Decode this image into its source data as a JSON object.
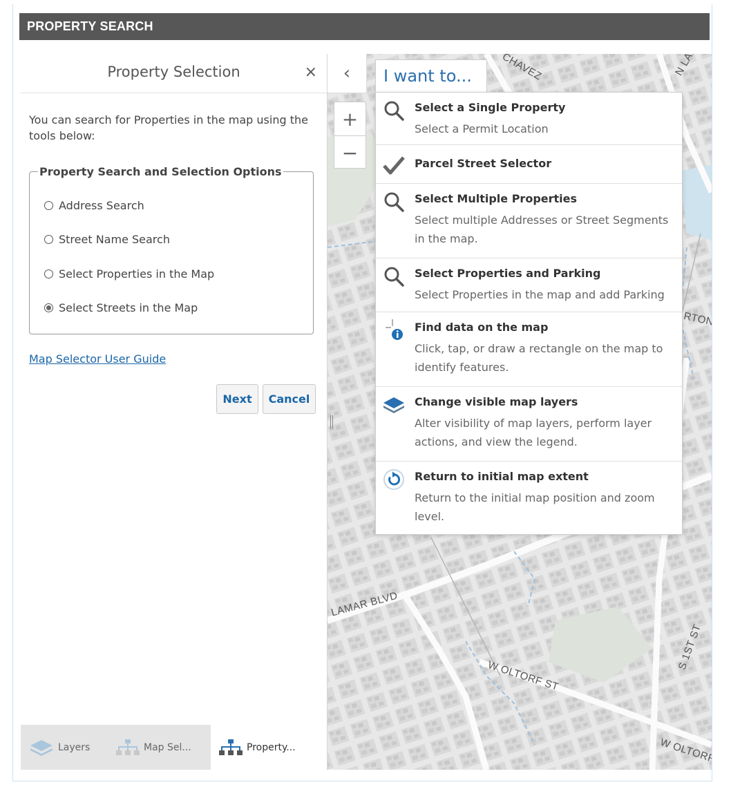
{
  "app": {
    "title": "PROPERTY SEARCH"
  },
  "panel": {
    "title": "Property Selection",
    "close_glyph": "×",
    "intro": "You can search for Properties in the map using the tools below:",
    "fieldset_legend": "Property Search and Selection Options",
    "options": [
      {
        "label": "Address Search",
        "checked": false
      },
      {
        "label": "Street Name Search",
        "checked": false
      },
      {
        "label": "Select Properties in the Map",
        "checked": false
      },
      {
        "label": "Select Streets in the Map",
        "checked": true
      }
    ],
    "guide_link": "Map Selector User Guide",
    "next_label": "Next",
    "cancel_label": "Cancel"
  },
  "bottom_tabs": [
    {
      "label": "Layers",
      "icon": "layers-icon",
      "active": false
    },
    {
      "label": "Map Sel...",
      "icon": "hierarchy-icon",
      "active": false
    },
    {
      "label": "Property...",
      "icon": "hierarchy-icon",
      "active": true
    }
  ],
  "map": {
    "collapse_glyph": "‹",
    "zoom_in": "+",
    "zoom_out": "−",
    "labels": [
      "N LAMAR B",
      "CHAVEZ",
      "RTON SP",
      "LAMAR BLVD",
      "W OLTORF ST",
      "S 1ST ST",
      "W OLTORF"
    ],
    "i_want_to": "I want to...",
    "menu": [
      {
        "title": "Select a Single Property",
        "desc": "Select a Permit Location",
        "icon": "search-icon"
      },
      {
        "title": "Parcel Street Selector",
        "desc": "",
        "icon": "checkmark-icon"
      },
      {
        "title": "Select Multiple Properties",
        "desc": "Select multiple Addresses or Street Segments in the map.",
        "icon": "search-icon"
      },
      {
        "title": "Select Properties and Parking",
        "desc": "Select Properties in the map and add Parking",
        "icon": "search-icon"
      },
      {
        "title": "Find data on the map",
        "desc": "Click, tap, or draw a rectangle on the map to identify features.",
        "icon": "identify-icon"
      },
      {
        "title": "Change visible map layers",
        "desc": "Alter visibility of map layers, perform layer actions, and view the legend.",
        "icon": "layers-icon"
      },
      {
        "title": "Return to initial map extent",
        "desc": "Return to the initial map position and zoom level.",
        "icon": "refresh-icon"
      }
    ]
  },
  "colors": {
    "title_bar": "#575757",
    "link": "#1a66a8",
    "accent": "#2a6fb0"
  }
}
